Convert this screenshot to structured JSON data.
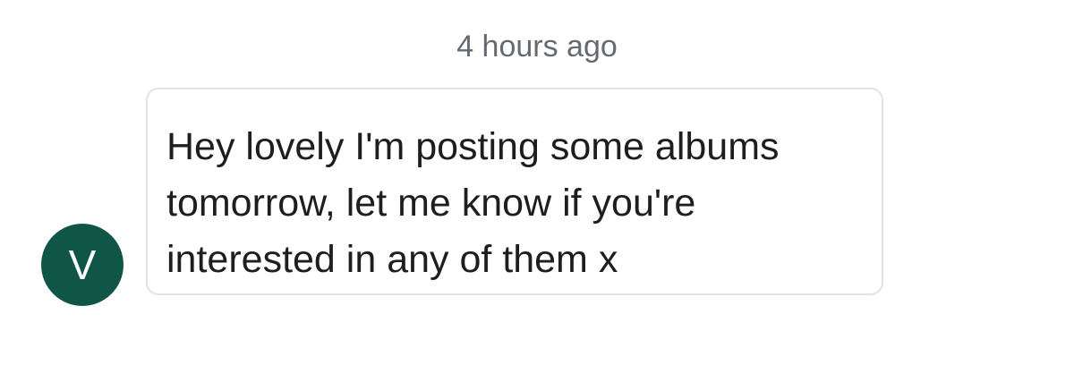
{
  "conversation": {
    "timestamp": "4 hours ago",
    "message": {
      "sender_initial": "V",
      "text": "Hey lovely I'm posting some albums tomorrow, let me know if you're interested in any of them x"
    }
  },
  "colors": {
    "avatar_background": "#0f5647",
    "bubble_border": "#e2e3e5",
    "timestamp_text": "#666a70",
    "message_text": "#1e1e1e"
  },
  "icons": {
    "avatar": "user-avatar-icon"
  }
}
